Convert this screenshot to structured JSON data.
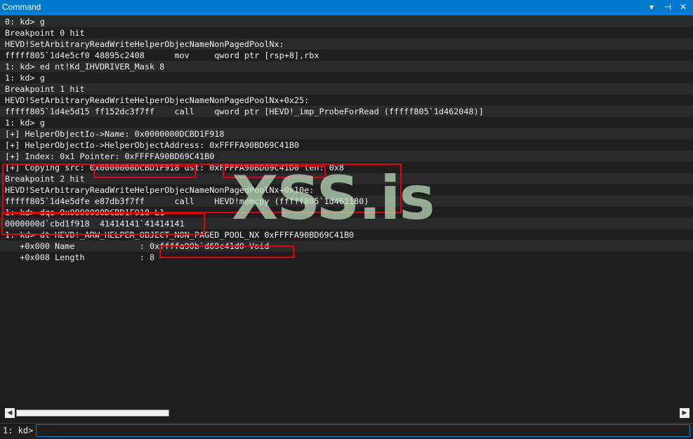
{
  "window": {
    "title": "Command",
    "dropdown_glyph": "▾",
    "pin_glyph": "⊣",
    "close_glyph": "✕"
  },
  "output_lines": [
    "0: kd> g",
    "Breakpoint 0 hit",
    "HEVD!SetArbitraryReadWriteHelperObjecNameNonPagedPoolNx:",
    "fffff805`1d4e5cf0 48895c2408      mov     qword ptr [rsp+8],rbx",
    "1: kd> ed nt!Kd_IHVDRIVER_Mask 8",
    "1: kd> g",
    "Breakpoint 1 hit",
    "HEVD!SetArbitraryReadWriteHelperObjecNameNonPagedPoolNx+0x25:",
    "fffff805`1d4e5d15 ff152dc3f7ff    call    qword ptr [HEVD!_imp_ProbeForRead (fffff805`1d462048)]",
    "1: kd> g",
    "[+] HelperObjectIo->Name: 0x0000000DCBD1F918",
    "[+] HelperObjectIo->HelperObjectAddress: 0xFFFFA90BD69C41B0",
    "[+] Index: 0x1 Pointer: 0xFFFFA90BD69C41B0",
    "[+] Copying src: 0x0000000DCBD1F918 dst: 0xFFFFA90BD69C41D0 len: 0x8",
    "Breakpoint 2 hit",
    "HEVD!SetArbitraryReadWriteHelperObjecNameNonPagedPoolNx+0x10e:",
    "fffff805`1d4e5dfe e87db3f7ff      call    HEVD!memcpy (fffff805`1d461180)",
    "1: kd> dqs 0x0000000DCBD1F918 L1",
    "0000000d`cbd1f918  41414141`41414141",
    "1: kd> dt HEVD!_ARW_HELPER_OBJECT_NON_PAGED_POOL_NX 0xFFFFA90BD69C41B0",
    "   +0x000 Name             : 0xffffa90b`d69c41d0 Void",
    "   +0x008 Length           : 8"
  ],
  "watermark": "XSS.is",
  "scrollbar": {
    "left_arrow": "◀",
    "right_arrow": "▶"
  },
  "command": {
    "prompt": "1: kd>",
    "value": ""
  }
}
